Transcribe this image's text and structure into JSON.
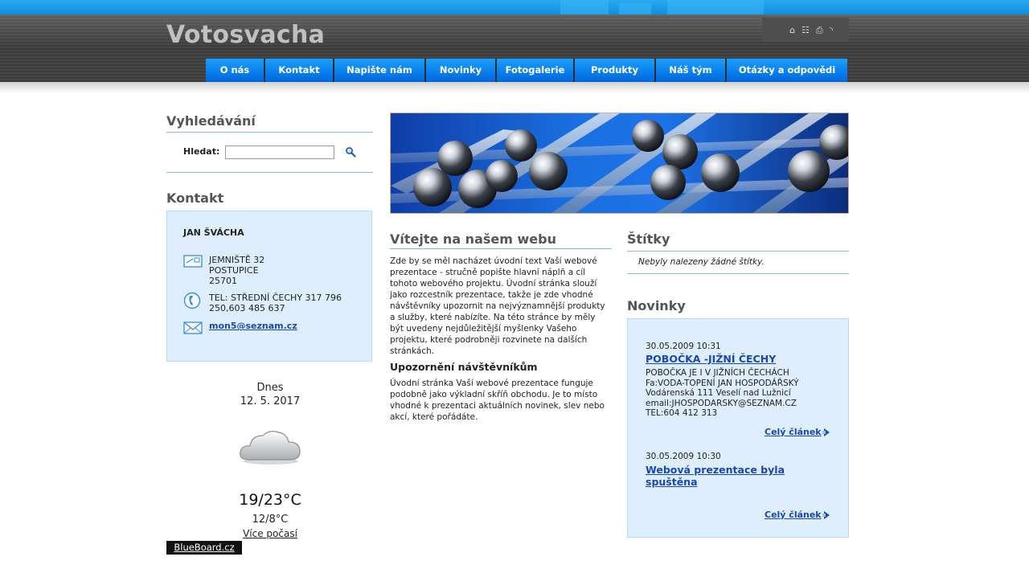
{
  "site": {
    "title": "Votosvacha"
  },
  "nav": [
    {
      "label": "O nás"
    },
    {
      "label": "Kontakt"
    },
    {
      "label": "Napište nám"
    },
    {
      "label": "Novinky"
    },
    {
      "label": "Fotogalerie"
    },
    {
      "label": "Produkty"
    },
    {
      "label": "Náš tým"
    },
    {
      "label": "Otázky a odpovědi"
    }
  ],
  "top_icons": [
    "home-icon",
    "sitemap-icon",
    "print-icon",
    "rss-icon"
  ],
  "search": {
    "title": "Vyhledávání",
    "label": "Hledat:",
    "value": "",
    "placeholder": ""
  },
  "contact": {
    "title": "Kontakt",
    "name": "JAN ŠVÁCHA",
    "address": [
      "JEMNIŠTĚ 32",
      "POSTUPICE",
      "25701"
    ],
    "phone": [
      "TEL: STŘEDNÍ ČECHY 317 796",
      "250,603 485 637"
    ],
    "email": "mon5@seznam.cz"
  },
  "weather": {
    "today_label": "Dnes",
    "date": "12. 5. 2017",
    "icon": "cloud-icon",
    "temp_day": "19/23°C",
    "temp_night": "12/8°C",
    "more_link": "Více počasí",
    "provider": "BlueBoard.cz"
  },
  "intro": {
    "title": "Vítejte na našem webu",
    "text": "Zde by se měl nacházet úvodní text Vaší webové prezentace - stručně popište hlavní náplň a cíl tohoto webového projektu. Úvodní stránka slouží jako rozcestník prezentace, takže je zde vhodné návštěvníky upozornit na nejvýznamnější produkty a služby, které nabízíte. Na této stránce by měly být uvedeny nejdůležitější myšlenky Vašeho projektu, které podrobněji rozvinete na dalších stránkách.",
    "notice_title": "Upozornění návštěvníkům",
    "notice_text": "Úvodní stránka Vaší webové prezentace funguje podobně jako výkladní skříň obchodu. Je to místo vhodné k prezentaci aktuálních novinek, slev nebo akcí, které pořádáte."
  },
  "tags": {
    "title": "Štítky",
    "empty": "Nebyly nalezeny žádné štítky."
  },
  "news": {
    "title": "Novinky",
    "items": [
      {
        "date": "30.05.2009 10:31",
        "title": "POBOČKA -JIŽNÍ ČECHY",
        "body": [
          "POBOČKA JE I V JIŽNÍCH ČECHÁCH",
          "Fa:VODA-TOPENÍ JAN HOSPODÁŘSKÝ",
          "Vodárenská 111 Veselí nad Lužnicí",
          "email:JHOSPODARSKY@SEZNAM.CZ",
          "TEL:604 412 313"
        ],
        "more": "Celý článek"
      },
      {
        "date": "30.05.2009 10:30",
        "title": "Webová prezentace byla spuštěna",
        "body": [],
        "more": "Celý článek"
      }
    ]
  }
}
